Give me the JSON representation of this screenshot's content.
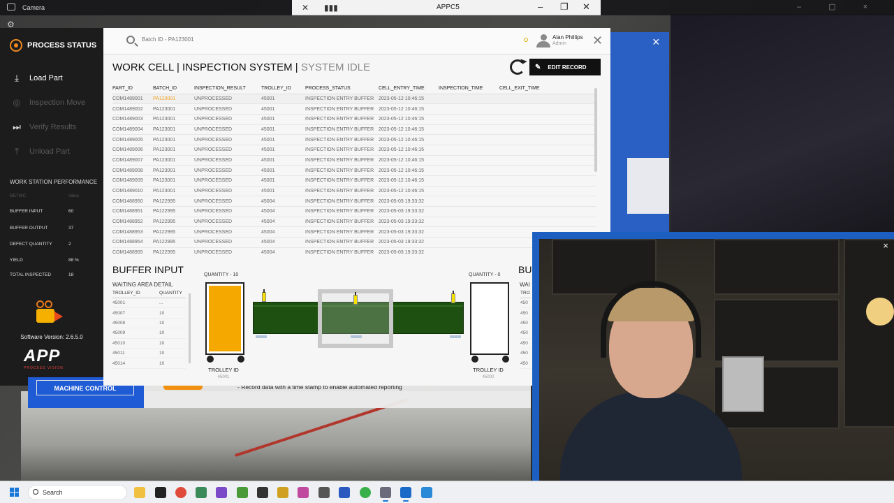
{
  "camera": {
    "title": "Camera",
    "record_text": "- Record data with a time stamp to enable automated reporting",
    "machine_control_label": "MACHINE CONTROL"
  },
  "app_window": {
    "title": "APPC5"
  },
  "sidebar": {
    "header": "PROCESS STATUS",
    "items": [
      {
        "label": "Load Part",
        "icon": "download-icon",
        "enabled": true
      },
      {
        "label": "Inspection Move",
        "icon": "target-icon",
        "enabled": false
      },
      {
        "label": "Verify Results",
        "icon": "skip-icon",
        "enabled": false
      },
      {
        "label": "Unload Part",
        "icon": "upload-icon",
        "enabled": false
      }
    ],
    "performance": {
      "title": "WORK STATION PERFORMANCE",
      "metric_header": "METRIC",
      "value_header": "Value",
      "rows": [
        {
          "metric": "BUFFER INPUT",
          "value": "60"
        },
        {
          "metric": "BUFFER OUTPUT",
          "value": "37"
        },
        {
          "metric": "DEFECT QUANTITY",
          "value": "2"
        },
        {
          "metric": "YIELD",
          "value": "88 %"
        },
        {
          "metric": "TOTAL INSPECTED",
          "value": "18"
        }
      ]
    },
    "software_version": "Software Version: 2.6.5.0",
    "logo_text": "APP",
    "logo_sub": "PROCESS VISION"
  },
  "header": {
    "search_placeholder": "Batch ID - PA123001",
    "user_name": "Alan Phillips",
    "user_role": "Admin",
    "title_part1": "WORK CELL",
    "title_sep": "|",
    "title_part2": "INSPECTION SYSTEM",
    "title_status": "SYSTEM IDLE",
    "edit_button": "EDIT RECORD"
  },
  "table": {
    "columns": [
      "PART_ID",
      "BATCH_ID",
      "INSPECTION_RESULT",
      "TROLLEY_ID",
      "PROCESS_STATUS",
      "CELL_ENTRY_TIME",
      "INSPECTION_TIME",
      "CELL_EXIT_TIME"
    ],
    "rows": [
      [
        "COM1489001",
        "PA123001",
        "UNPROCESSED",
        "45001",
        "INSPECTION ENTRY BUFFER",
        "2023-05-12 10:46:15",
        "",
        ""
      ],
      [
        "COM1489002",
        "PA123001",
        "UNPROCESSED",
        "45001",
        "INSPECTION ENTRY BUFFER",
        "2023-05-12 10:46:15",
        "",
        ""
      ],
      [
        "COM1489003",
        "PA123001",
        "UNPROCESSED",
        "45001",
        "INSPECTION ENTRY BUFFER",
        "2023-05-12 10:46:15",
        "",
        ""
      ],
      [
        "COM1489004",
        "PA123001",
        "UNPROCESSED",
        "45001",
        "INSPECTION ENTRY BUFFER",
        "2023-05-12 10:46:15",
        "",
        ""
      ],
      [
        "COM1489005",
        "PA123001",
        "UNPROCESSED",
        "45001",
        "INSPECTION ENTRY BUFFER",
        "2023-05-12 10:46:15",
        "",
        ""
      ],
      [
        "COM1489006",
        "PA123001",
        "UNPROCESSED",
        "45001",
        "INSPECTION ENTRY BUFFER",
        "2023-05-12 10:46:15",
        "",
        ""
      ],
      [
        "COM1489007",
        "PA123001",
        "UNPROCESSED",
        "45001",
        "INSPECTION ENTRY BUFFER",
        "2023-05-12 10:46:15",
        "",
        ""
      ],
      [
        "COM1489008",
        "PA123001",
        "UNPROCESSED",
        "45001",
        "INSPECTION ENTRY BUFFER",
        "2023-05-12 10:46:15",
        "",
        ""
      ],
      [
        "COM1489009",
        "PA123001",
        "UNPROCESSED",
        "45001",
        "INSPECTION ENTRY BUFFER",
        "2023-05-12 10:46:15",
        "",
        ""
      ],
      [
        "COM1489010",
        "PA123001",
        "UNPROCESSED",
        "45001",
        "INSPECTION ENTRY BUFFER",
        "2023-05-12 10:46:15",
        "",
        ""
      ],
      [
        "COM1488950",
        "PA122995",
        "UNPROCESSED",
        "45004",
        "INSPECTION ENTRY BUFFER",
        "2023-05-03 19:33:32",
        "",
        ""
      ],
      [
        "COM1488951",
        "PA122995",
        "UNPROCESSED",
        "45004",
        "INSPECTION ENTRY BUFFER",
        "2023-05-03 19:33:32",
        "",
        ""
      ],
      [
        "COM1488952",
        "PA122995",
        "UNPROCESSED",
        "45004",
        "INSPECTION ENTRY BUFFER",
        "2023-05-03 19:33:32",
        "",
        ""
      ],
      [
        "COM1488953",
        "PA122995",
        "UNPROCESSED",
        "45004",
        "INSPECTION ENTRY BUFFER",
        "2023-05-03 19:33:32",
        "",
        ""
      ],
      [
        "COM1488954",
        "PA122995",
        "UNPROCESSED",
        "45004",
        "INSPECTION ENTRY BUFFER",
        "2023-05-03 19:33:32",
        "",
        ""
      ],
      [
        "COM1488955",
        "PA122995",
        "UNPROCESSED",
        "45004",
        "INSPECTION ENTRY BUFFER",
        "2023-05-03 19:33:32",
        "",
        ""
      ]
    ]
  },
  "buffer_input": {
    "title": "BUFFER INPUT",
    "title_right": "BU",
    "waiting_title": "WAITING AREA DETAIL",
    "waiting_title_right": "WAI",
    "col_trolley": "TROLLEY_ID",
    "col_quantity": "QUANTITY",
    "col_trolley_right": "TRO",
    "waiting_rows": [
      {
        "trolley": "45001",
        "qty": "..."
      },
      {
        "trolley": "45007",
        "qty": "10"
      },
      {
        "trolley": "45008",
        "qty": "10"
      },
      {
        "trolley": "45009",
        "qty": "10"
      },
      {
        "trolley": "45010",
        "qty": "10"
      },
      {
        "trolley": "45011",
        "qty": "10"
      },
      {
        "trolley": "45014",
        "qty": "10"
      }
    ],
    "waiting_rows_right": [
      "450",
      "450",
      "450",
      "450",
      "450",
      "450",
      "450"
    ],
    "left_trolley": {
      "quantity_label": "QUANTITY - 10",
      "id_label": "TROLLEY ID",
      "id_value": "45001",
      "fill_fraction": 0.98
    },
    "right_trolley": {
      "quantity_label": "QUANTITY - 0",
      "id_label": "TROLLEY ID",
      "id_value": "45002",
      "fill_fraction": 0
    }
  },
  "webcam": {
    "close": "×"
  },
  "taskbar": {
    "search_label": "Search"
  },
  "colors": {
    "accent_orange": "#f5a800",
    "conveyor_green": "#1e5012",
    "webcam_border": "#1d5fc0",
    "sidebar_bg": "#1c1c1c"
  }
}
